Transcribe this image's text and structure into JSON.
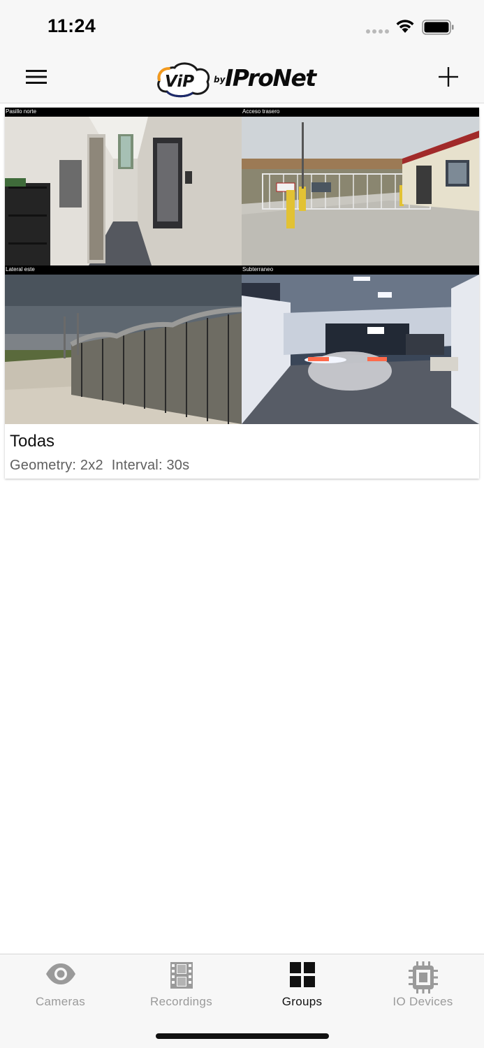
{
  "status_bar": {
    "time": "11:24"
  },
  "nav": {
    "logo_vip": "ViP",
    "logo_by": "by",
    "logo_ipronet": "IProNet"
  },
  "group": {
    "name": "Todas",
    "geometry_label": "Geometry: 2x2",
    "interval_label": "Interval: 30s",
    "cameras": [
      {
        "label": "Pasillo norte"
      },
      {
        "label": "Acceso trasero"
      },
      {
        "label": "Lateral este"
      },
      {
        "label": "Subterraneo"
      }
    ]
  },
  "tabs": [
    {
      "label": "Cameras",
      "icon": "eye-icon",
      "active": false
    },
    {
      "label": "Recordings",
      "icon": "film-icon",
      "active": false
    },
    {
      "label": "Groups",
      "icon": "grid-icon",
      "active": true
    },
    {
      "label": "IO Devices",
      "icon": "chip-icon",
      "active": false
    }
  ],
  "colors": {
    "bar_background": "#f7f7f7",
    "active_tab": "#111111",
    "inactive_tab": "#9a9a9a",
    "logo_orange": "#f29a1f",
    "logo_navy": "#1d2a6b"
  }
}
